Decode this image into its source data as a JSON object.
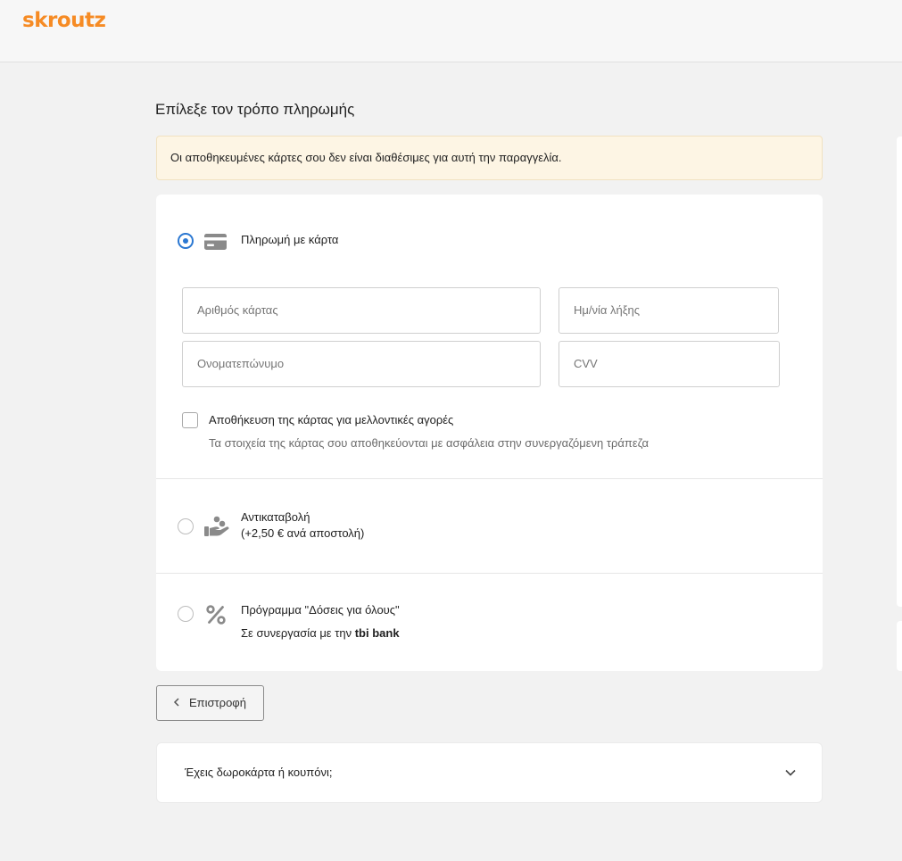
{
  "header": {
    "logo_text": "skroutz",
    "brand_color": "#f68b24"
  },
  "page": {
    "title": "Επίλεξε τον τρόπο πληρωμής"
  },
  "notice": {
    "text": "Οι αποθηκευμένες κάρτες σου δεν είναι διαθέσιμες για αυτή την παραγγελία."
  },
  "payment": {
    "card": {
      "label": "Πληρωμή με κάρτα",
      "selected": true,
      "icon": "credit-card-icon",
      "fields": {
        "number_placeholder": "Αριθμός κάρτας",
        "expiry_placeholder": "Ημ/νία λήξης",
        "name_placeholder": "Ονοματεπώνυμο",
        "cvv_placeholder": "CVV"
      },
      "save_label": "Αποθήκευση της κάρτας για μελλοντικές αγορές",
      "save_hint": "Τα στοιχεία της κάρτας σου αποθηκεύονται με ασφάλεια στην συνεργαζόμενη τράπεζα"
    },
    "cod": {
      "label": "Αντικαταβολή",
      "fee": "(+2,50 € ανά αποστολή)",
      "icon": "hand-coins-icon"
    },
    "installments": {
      "label": "Πρόγραμμα \"Δόσεις για όλους\"",
      "partner_prefix": "Σε συνεργασία με την",
      "partner_name": "tbi bank",
      "icon": "percent-icon"
    }
  },
  "actions": {
    "back_label": "Επιστροφή"
  },
  "coupon": {
    "label": "Έχεις δωροκάρτα ή κουπόνι;"
  },
  "colors": {
    "accent": "#2b78d2",
    "notice_bg": "#fdf5e4"
  }
}
